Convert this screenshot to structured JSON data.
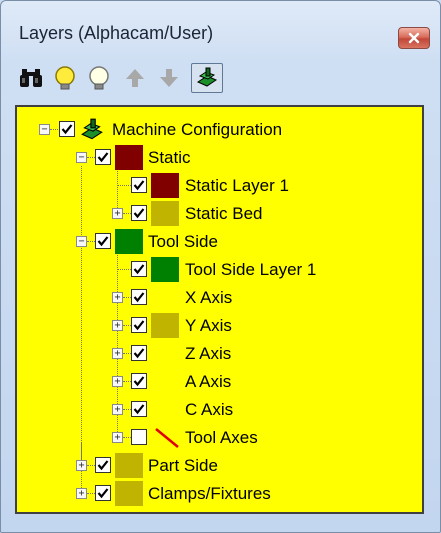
{
  "window": {
    "title": "Layers (Alphacam/User)"
  },
  "toolbar": {
    "items": [
      {
        "name": "binoculars-icon",
        "tooltip": ""
      },
      {
        "name": "bulb-on-icon"
      },
      {
        "name": "bulb-off-icon"
      },
      {
        "name": "arrow-up-icon"
      },
      {
        "name": "arrow-down-icon"
      },
      {
        "name": "machine-config-icon",
        "pressed": true
      }
    ]
  },
  "tree": {
    "root": {
      "label": "Machine Configuration",
      "checked": true
    },
    "static": {
      "label": "Static",
      "checked": true,
      "color": "#800000"
    },
    "static_layer_1": {
      "label": "Static Layer 1",
      "checked": true,
      "color": "#800000"
    },
    "static_bed": {
      "label": "Static Bed",
      "checked": true,
      "color": "#c0b400"
    },
    "tool_side": {
      "label": "Tool Side",
      "checked": true,
      "color": "#008000"
    },
    "tool_side_layer_1": {
      "label": "Tool Side Layer 1",
      "checked": true,
      "color": "#008000"
    },
    "x_axis": {
      "label": "X Axis",
      "checked": true
    },
    "y_axis": {
      "label": "Y Axis",
      "checked": true,
      "color": "#c0b400"
    },
    "z_axis": {
      "label": "Z Axis",
      "checked": true
    },
    "a_axis": {
      "label": "A Axis",
      "checked": true
    },
    "c_axis": {
      "label": "C Axis",
      "checked": true
    },
    "tool_axes": {
      "label": "Tool Axes",
      "checked": false,
      "color": "#e00000"
    },
    "part_side": {
      "label": "Part Side",
      "checked": true,
      "color": "#c0b400"
    },
    "clamps_fixtures": {
      "label": "Clamps/Fixtures",
      "checked": true,
      "color": "#c0b400"
    }
  },
  "colors": {
    "panel_background": "#ffff00",
    "dark_red": "#800000",
    "green": "#008000",
    "olive": "#c0b400",
    "red_line": "#e00000"
  }
}
